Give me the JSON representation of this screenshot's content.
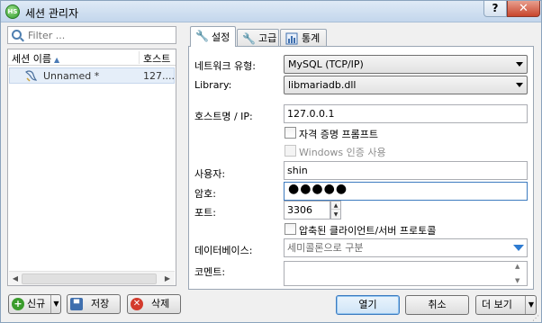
{
  "window": {
    "title": "세션 관리자",
    "app_icon_text": "HS",
    "help_label": "?",
    "close_label": "✕"
  },
  "sessions": {
    "filter_placeholder": "Filter ...",
    "columns": {
      "name": "세션 이름",
      "host": "호스트"
    },
    "rows": [
      {
        "name": "Unnamed *",
        "host": "127...."
      }
    ]
  },
  "left_buttons": {
    "new_label": "신규",
    "save_label": "저장",
    "delete_label": "삭제"
  },
  "tabs": [
    {
      "label": "설정",
      "icon": "wrench-icon",
      "active": true
    },
    {
      "label": "고급",
      "icon": "wrench-orange-icon",
      "active": false
    },
    {
      "label": "통계",
      "icon": "bar-chart-icon",
      "active": false
    }
  ],
  "settings": {
    "network_type_label": "네트워크 유형:",
    "network_type_value": "MySQL (TCP/IP)",
    "library_label": "Library:",
    "library_value": "libmariadb.dll",
    "hostname_label": "호스트명 / IP:",
    "hostname_value": "127.0.0.1",
    "prompt_credentials_label": "자격 증명 프롬프트",
    "windows_auth_label": "Windows 인증 사용",
    "user_label": "사용자:",
    "user_value": "shin",
    "password_label": "암호:",
    "password_dots": "●●●●●",
    "port_label": "포트:",
    "port_value": "3306",
    "compressed_label": "압축된 클라이언트/서버 프로토콜",
    "databases_label": "데이터베이스:",
    "databases_placeholder": "세미콜론으로 구분",
    "comment_label": "코멘트:",
    "comment_value": ""
  },
  "dialog_buttons": {
    "open_label": "열기",
    "cancel_label": "취소",
    "more_label": "더 보기"
  },
  "colors": {
    "accent": "#3d7bbf",
    "new_green": "#3a9c2c",
    "delete_red": "#d33a2c",
    "dropdown_blue": "#2e7bd1"
  }
}
